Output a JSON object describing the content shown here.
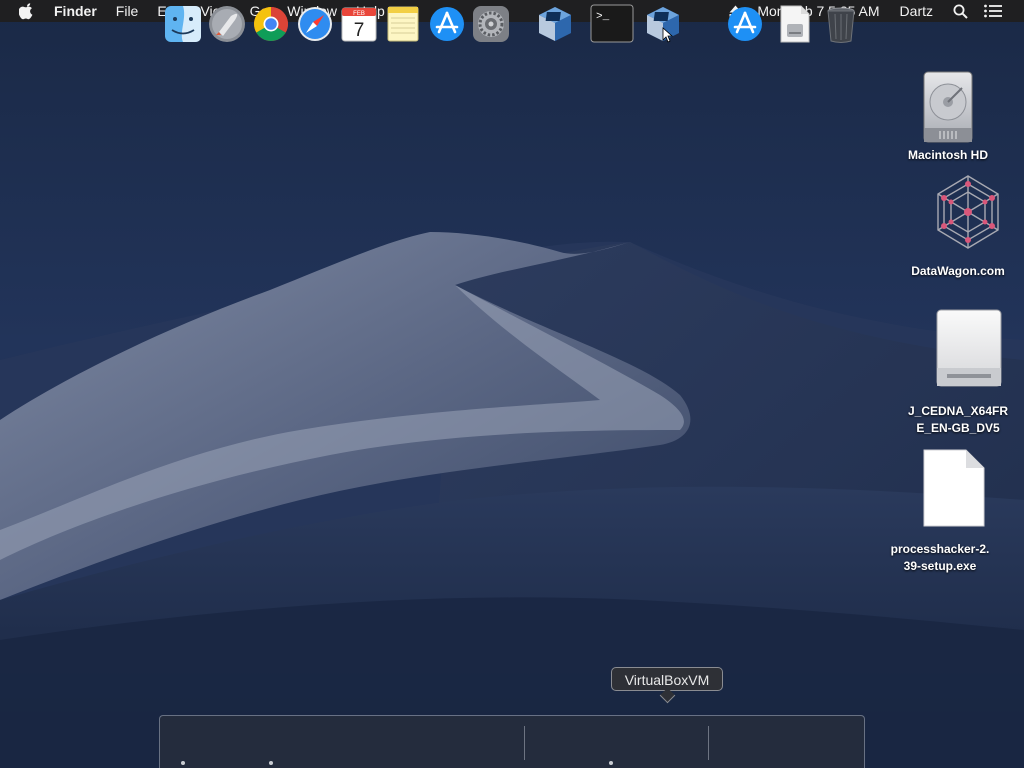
{
  "menubar": {
    "apple_icon": "apple-logo-icon",
    "app_name": "Finder",
    "menus": [
      "File",
      "Edit",
      "View",
      "Go",
      "Window",
      "Help"
    ],
    "datetime": "Mon Feb 7  5:25 AM",
    "user": "Dartz",
    "eject_icon": "eject-icon",
    "spotlight_icon": "spotlight-search-icon",
    "notification_icon": "notification-center-icon"
  },
  "desktop": {
    "icons": [
      {
        "label": "Macintosh HD",
        "icon": "hard-drive-icon"
      },
      {
        "label": "DataWagon.com",
        "icon": "network-share-icon"
      },
      {
        "label": "J_CEDNA_X64FR\nE_EN-GB_DV5",
        "icon": "optical-disc-drive-icon"
      },
      {
        "label": "processhacker-2.\n39-setup.exe",
        "icon": "document-icon"
      }
    ]
  },
  "tooltip": {
    "text": "VirtualBoxVM"
  },
  "dock": {
    "items": [
      {
        "name": "Finder",
        "icon": "finder-icon",
        "running": true
      },
      {
        "name": "Launchpad",
        "icon": "launchpad-rocket-icon",
        "running": false
      },
      {
        "name": "Google Chrome",
        "icon": "chrome-icon",
        "running": true
      },
      {
        "name": "Safari",
        "icon": "safari-compass-icon",
        "running": false
      },
      {
        "name": "Calendar",
        "icon": "calendar-icon",
        "running": false,
        "month": "FEB",
        "day": "7"
      },
      {
        "name": "Notes",
        "icon": "notes-icon",
        "running": false
      },
      {
        "name": "App Store",
        "icon": "app-store-icon",
        "running": false
      },
      {
        "name": "System Preferences",
        "icon": "gear-icon",
        "running": false
      },
      {
        "name": "VirtualBox",
        "icon": "virtualbox-icon",
        "running": false
      },
      {
        "name": "Terminal",
        "icon": "terminal-icon",
        "running": true,
        "prompt": ">_"
      },
      {
        "name": "VirtualBoxVM",
        "icon": "virtualbox-icon",
        "running": false
      },
      {
        "name": "App Store",
        "icon": "app-store-icon",
        "running": false
      },
      {
        "name": "Disk Image",
        "icon": "disk-image-document-icon",
        "running": false
      },
      {
        "name": "Trash",
        "icon": "trash-icon",
        "running": false
      }
    ]
  },
  "colors": {
    "menubar_bg": "#1f1f21",
    "sky_top": "#1b2a44",
    "sky_bottom": "#2a3b5a",
    "dune_light": "#8a95ab"
  }
}
